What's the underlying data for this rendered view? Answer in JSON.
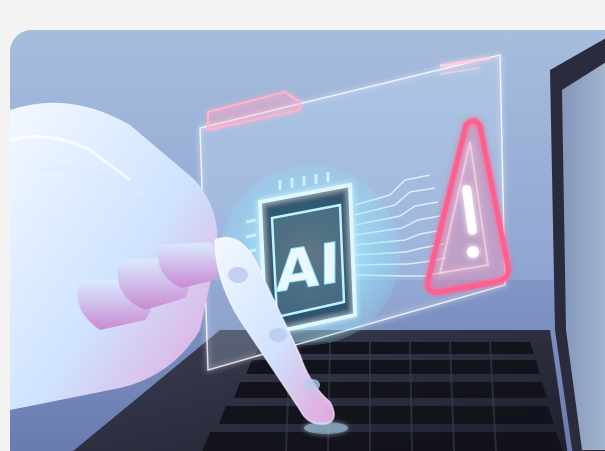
{
  "illustration": {
    "chip_text": "AI",
    "icons": [
      "ai-chip-icon",
      "warning-triangle-icon",
      "folder-icon"
    ],
    "colors": {
      "background": "#f3f3f3",
      "sky_top": "#9bb4d6",
      "sky_bottom": "#5c6fa3",
      "hologram_cyan": "#7fe8ff",
      "hologram_pink": "#ff8fb0",
      "robot_white": "#eef3ff",
      "robot_pink": "#e8a0d6",
      "laptop_dark": "#2b2d3a"
    }
  }
}
